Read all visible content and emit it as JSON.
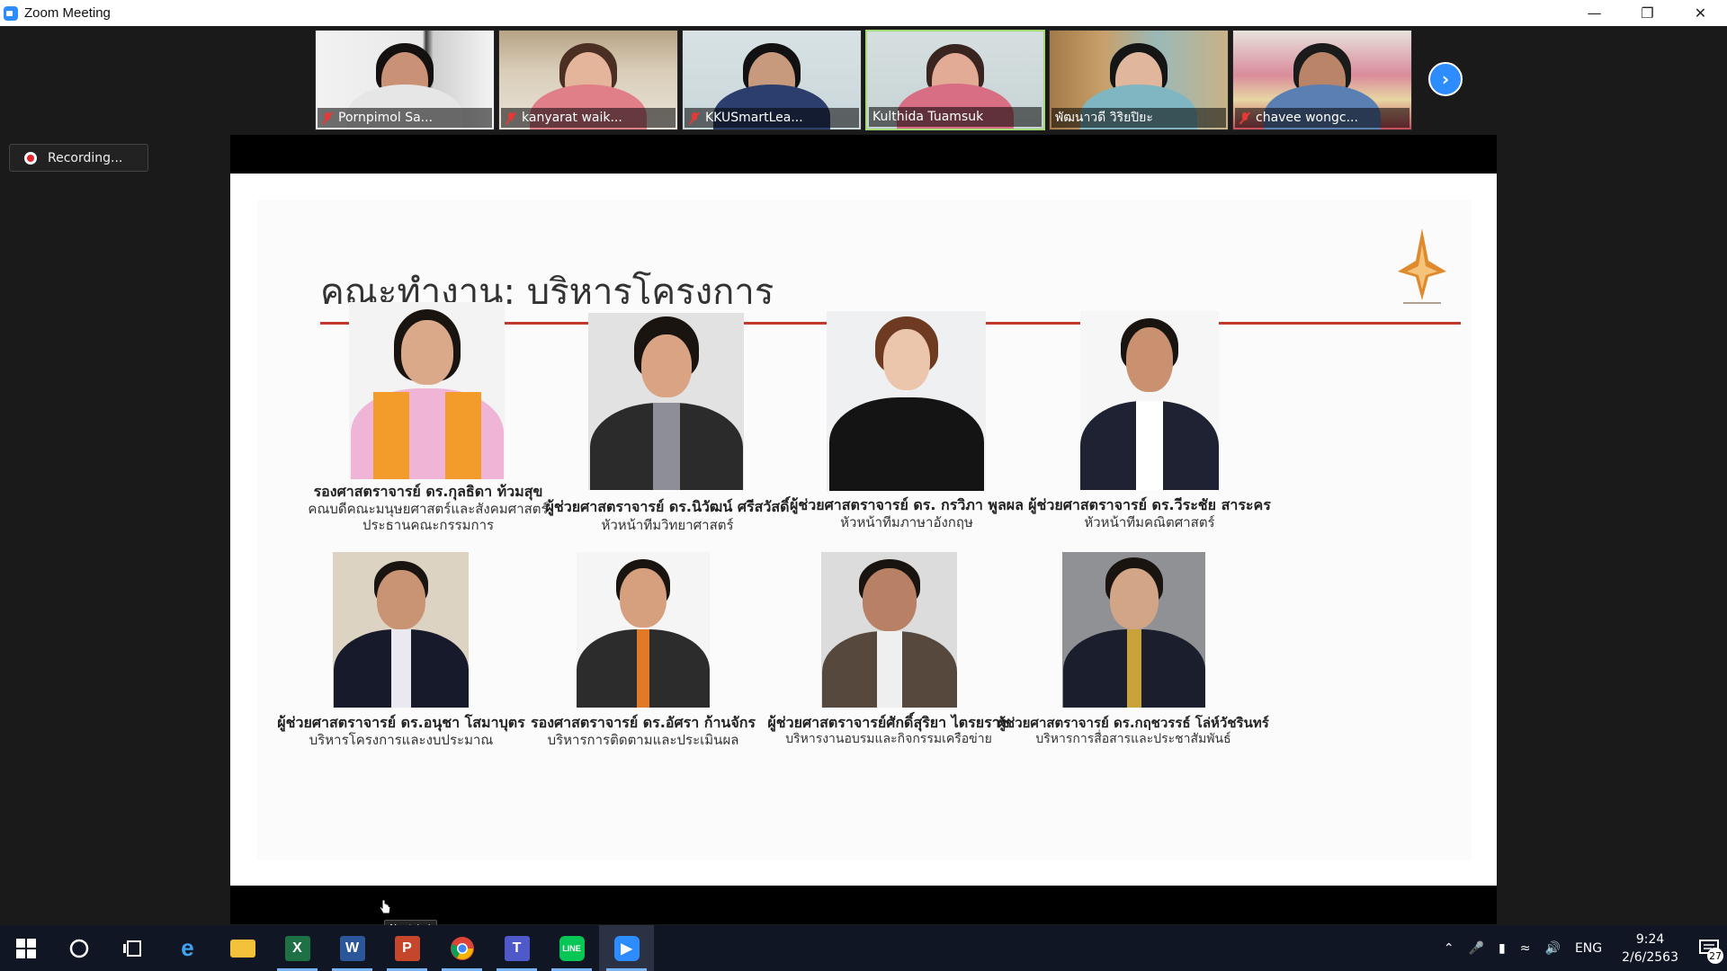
{
  "window": {
    "title": "Zoom Meeting",
    "minimize_icon": "minimize-icon",
    "restore_icon": "restore-icon",
    "close_icon": "close-icon"
  },
  "participants": [
    {
      "name": "Pornpimol Sa...",
      "muted": true,
      "active": false
    },
    {
      "name": "kanyarat waik...",
      "muted": true,
      "active": false
    },
    {
      "name": "KKUSmartLea...",
      "muted": true,
      "active": false
    },
    {
      "name": "Kulthida Tuamsuk",
      "muted": false,
      "active": true
    },
    {
      "name": "พัฒนาวดี วิริยปิยะ",
      "muted": false,
      "active": false
    },
    {
      "name": "chavee wongc...",
      "muted": true,
      "active": false
    }
  ],
  "recording": {
    "label": "Recording..."
  },
  "slide": {
    "title": "คณะทำงาน: บริหารโครงการ",
    "people": [
      {
        "name": "รองศาสตราจารย์ ดร.กุลธิดา ท้วมสุข",
        "roles": [
          "คณบดีคณะมนุษยศาสตร์และสังคมศาสตร์",
          "ประธานคณะกรรมการ"
        ]
      },
      {
        "name": "ผู้ช่วยศาสตราจารย์ ดร.นิวัฒน์ ศรีสวัสดิ์",
        "roles": [
          "หัวหน้าทีมวิทยาศาสตร์"
        ]
      },
      {
        "name": "ผู้ช่วยศาสตราจารย์ ดร. กรวิภา พูลผล",
        "roles": [
          "หัวหน้าทีมภาษาอังกฤษ"
        ]
      },
      {
        "name": "ผู้ช่วยศาสตราจารย์ ดร.วีระชัย สาระคร",
        "roles": [
          "หัวหน้าทีมคณิตศาสตร์"
        ]
      },
      {
        "name": "ผู้ช่วยศาสตราจารย์ ดร.อนุชา โสมาบุตร",
        "roles": [
          "บริหารโครงการและงบประมาณ"
        ]
      },
      {
        "name": "รองศาสตราจารย์ ดร.อัศรา ก้านจักร",
        "roles": [
          "บริหารการติดตามและประเมินผล"
        ]
      },
      {
        "name": "ผู้ช่วยศาสตราจารย์ศักดิ์สุริยา ไตรยราช",
        "roles": [
          "บริหารงานอบรมและกิจกรรมเครือข่าย"
        ]
      },
      {
        "name": "ผู้ช่วยศาสตราจารย์ ดร.กฤชวรรธ์ โล่ห์วัชรินทร์",
        "roles": [
          "บริหารการสื่อสารและประชาสัมพันธ์"
        ]
      }
    ]
  },
  "tooltip": {
    "text": "Next (→)"
  },
  "taskbar": {
    "apps": [
      "start-icon",
      "cortana-icon",
      "task-view-icon",
      "edge-icon",
      "file-explorer-icon",
      "excel-icon",
      "word-icon",
      "powerpoint-icon",
      "chrome-icon",
      "teams-icon",
      "line-icon",
      "zoom-icon"
    ],
    "language": "ENG",
    "time": "9:24",
    "date": "2/6/2563",
    "notification_count": "27"
  }
}
